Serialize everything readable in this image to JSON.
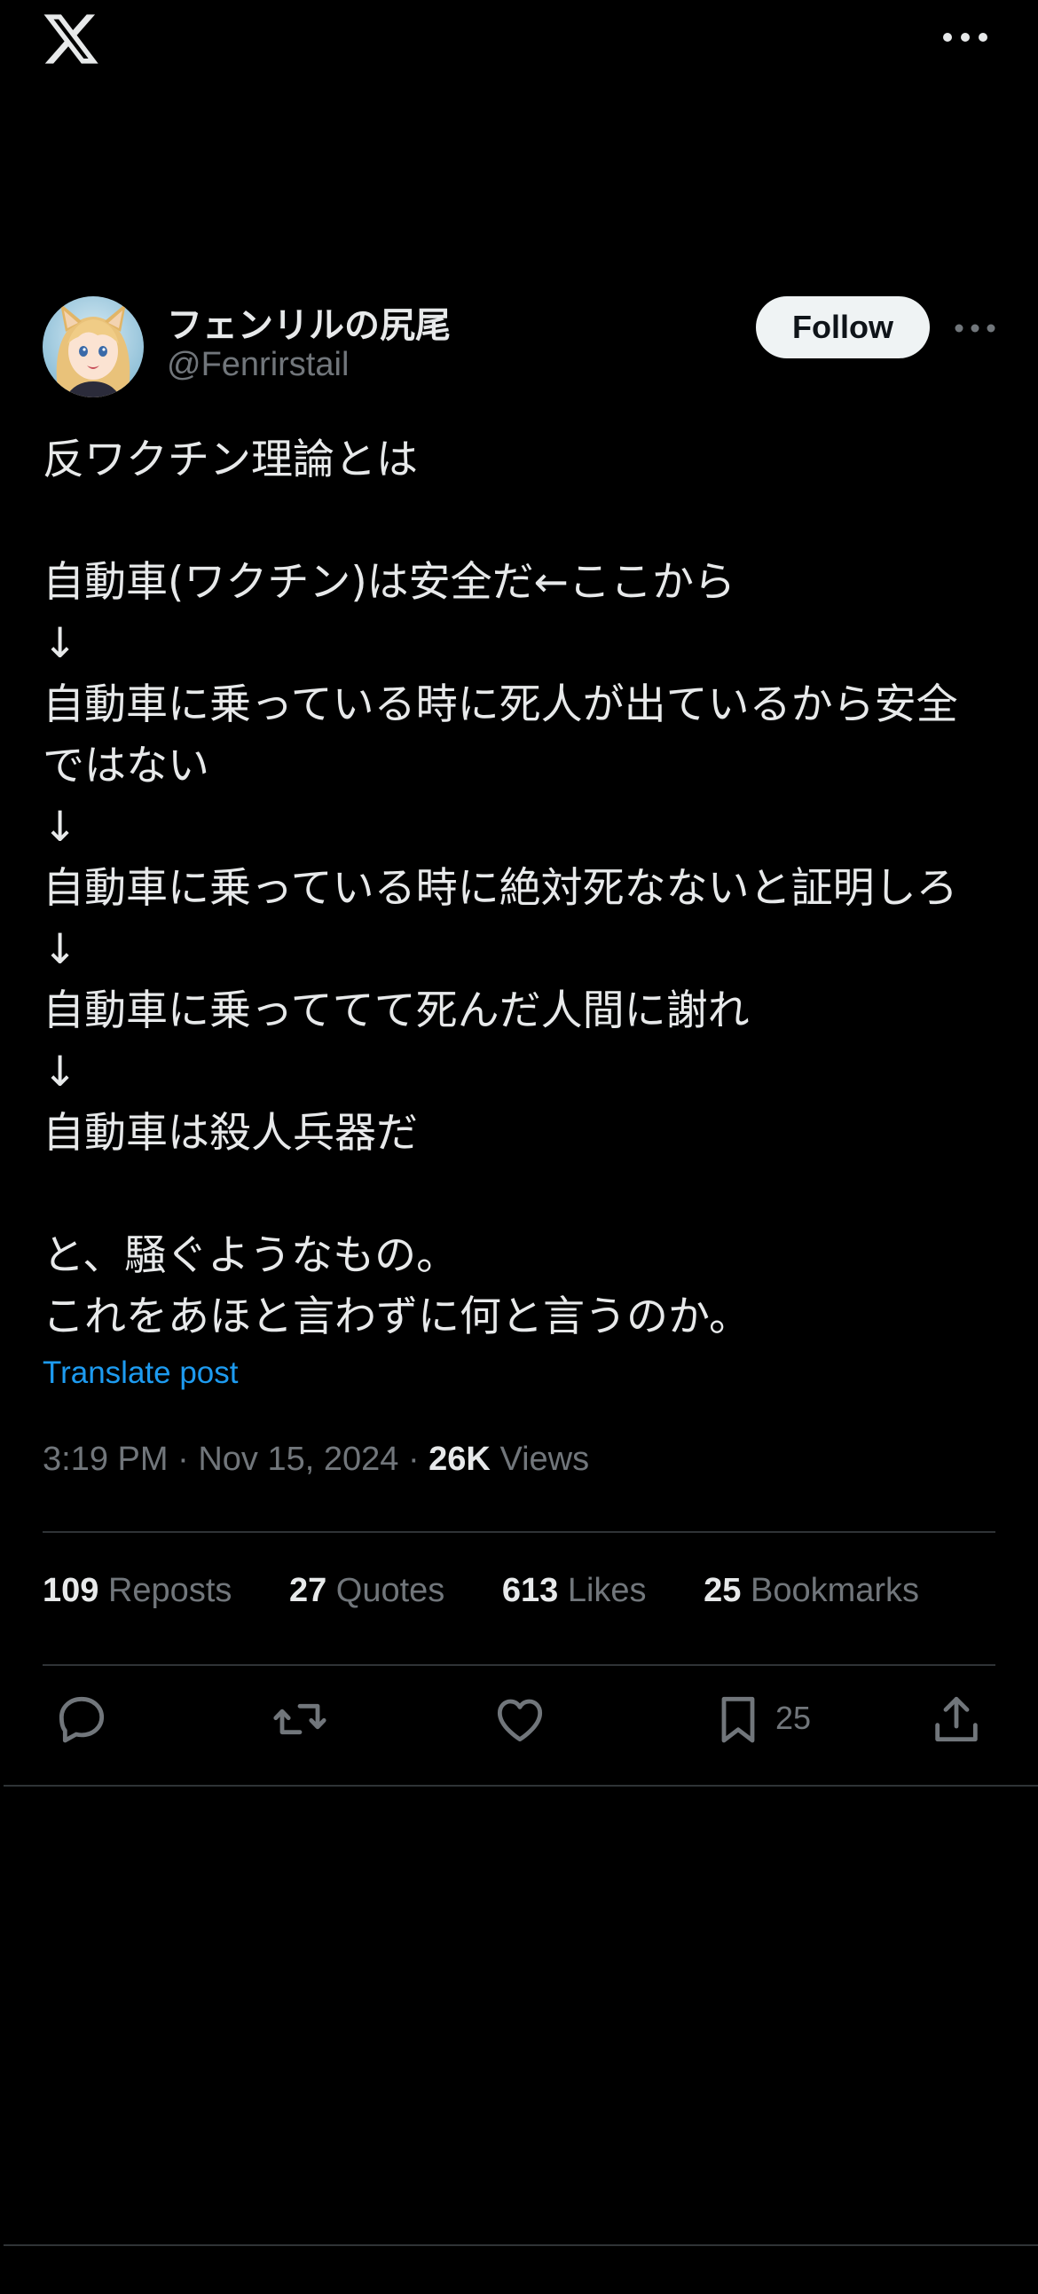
{
  "top_bar": {
    "logo_icon": "x-logo-icon",
    "more_icon": "more-horizontal-icon"
  },
  "author": {
    "display_name": "フェンリルの尻尾",
    "handle": "@Fenrirstail",
    "follow_label": "Follow"
  },
  "post": {
    "lines": [
      "反ワクチン理論とは",
      "",
      "自動車(ワクチン)は安全だ←ここから",
      "↓",
      "自動車に乗っている時に死人が出ているから安全",
      "ではない",
      "↓",
      "自動車に乗っている時に絶対死なないと証明しろ",
      "↓",
      "自動車に乗っててて死んだ人間に謝れ",
      "↓",
      "自動車は殺人兵器だ",
      "",
      "と、騒ぐようなもの。",
      "これをあほと言わずに何と言うのか。"
    ],
    "translate_label": "Translate post"
  },
  "meta": {
    "time": "3:19 PM",
    "separator": "·",
    "date": "Nov 15, 2024",
    "views_count": "26K",
    "views_label": "Views"
  },
  "stats": {
    "reposts_count": "109",
    "reposts_label": "Reposts",
    "quotes_count": "27",
    "quotes_label": "Quotes",
    "likes_count": "613",
    "likes_label": "Likes",
    "bookmarks_count": "25",
    "bookmarks_label": "Bookmarks"
  },
  "actions": {
    "reply_icon": "reply-icon",
    "repost_icon": "repost-icon",
    "like_icon": "heart-icon",
    "bookmark_icon": "bookmark-icon",
    "bookmark_count": "25",
    "share_icon": "share-icon"
  },
  "colors": {
    "background": "#000000",
    "text": "#e7e9ea",
    "muted": "#71767b",
    "link": "#1d9bf0",
    "divider": "#2f3336",
    "follow_bg": "#eff3f4"
  }
}
